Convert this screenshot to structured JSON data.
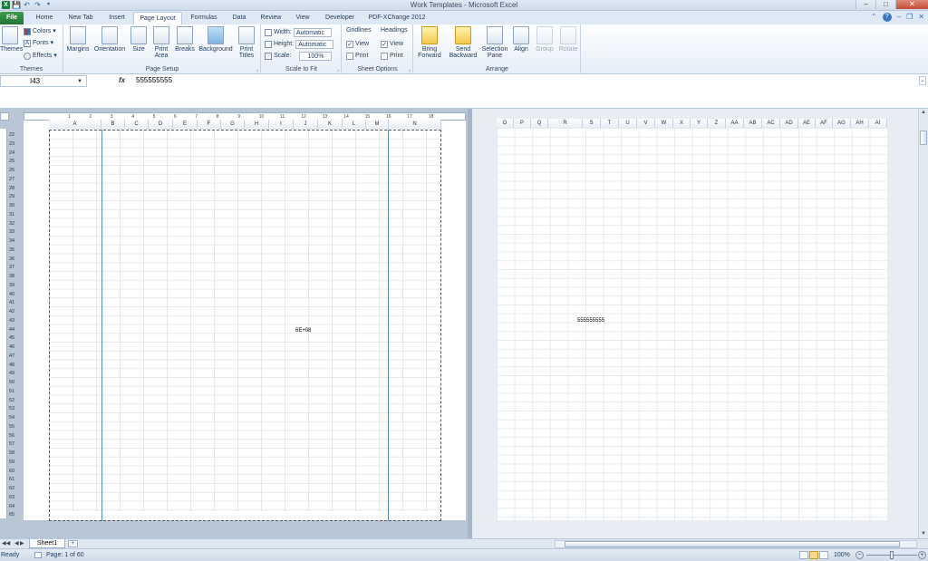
{
  "window": {
    "title": "Work Templates - Microsoft Excel",
    "app_icon_letter": "X",
    "quick_access": [
      "save-icon",
      "undo-icon",
      "redo-icon",
      "customize-icon"
    ],
    "controls": {
      "minimize": "–",
      "maximize": "□",
      "close": "✕"
    }
  },
  "tabs": [
    {
      "label": "File"
    },
    {
      "label": "Home"
    },
    {
      "label": "New Tab"
    },
    {
      "label": "Insert"
    },
    {
      "label": "Page Layout"
    },
    {
      "label": "Formulas"
    },
    {
      "label": "Data"
    },
    {
      "label": "Review"
    },
    {
      "label": "View"
    },
    {
      "label": "Developer"
    },
    {
      "label": "PDF-XChange 2012"
    }
  ],
  "ribbon": {
    "themes": {
      "label": "Themes",
      "themes_btn": "Themes",
      "colors": "Colors",
      "fonts": "Fonts",
      "effects": "Effects"
    },
    "page_setup": {
      "label": "Page Setup",
      "buttons": [
        "Margins",
        "Orientation",
        "Size",
        "Print Area",
        "Breaks",
        "Background",
        "Print Titles"
      ]
    },
    "scale_to_fit": {
      "label": "Scale to Fit",
      "width_label": "Width:",
      "width_value": "Automatic",
      "height_label": "Height:",
      "height_value": "Automatic",
      "scale_label": "Scale:",
      "scale_value": "100%"
    },
    "sheet_options": {
      "label": "Sheet Options",
      "gridlines": "Gridlines",
      "headings": "Headings",
      "view": "View",
      "print": "Print",
      "gridlines_view": true,
      "gridlines_print": false,
      "headings_view": true,
      "headings_print": false
    },
    "arrange": {
      "label": "Arrange",
      "buttons": [
        "Bring Forward",
        "Send Backward",
        "Selection Pane",
        "Align",
        "Group",
        "Rotate"
      ]
    }
  },
  "formula_bar": {
    "name_box": "I43",
    "fx": "fx",
    "value": "555555555"
  },
  "sheet": {
    "ruler_numbers": [
      "1",
      "2",
      "3",
      "4",
      "5",
      "6",
      "7",
      "8",
      "9",
      "10",
      "11",
      "12",
      "13",
      "14",
      "15",
      "16",
      "17",
      "18"
    ],
    "left_columns": [
      "A",
      "B",
      "C",
      "D",
      "E",
      "F",
      "G",
      "H",
      "I",
      "J",
      "K",
      "L",
      "M",
      "N"
    ],
    "right_columns": [
      "O",
      "P",
      "Q",
      "R",
      "S",
      "T",
      "U",
      "V",
      "W",
      "X",
      "Y",
      "Z",
      "AA",
      "AB",
      "AC",
      "AD",
      "AE",
      "AF",
      "AG",
      "AH",
      "AI"
    ],
    "rows": [
      "22",
      "23",
      "24",
      "25",
      "26",
      "27",
      "28",
      "29",
      "30",
      "31",
      "32",
      "33",
      "34",
      "35",
      "36",
      "37",
      "38",
      "39",
      "40",
      "41",
      "42",
      "43",
      "44",
      "45",
      "46",
      "47",
      "48",
      "49",
      "50",
      "51",
      "52",
      "53",
      "54",
      "55",
      "56",
      "57",
      "58",
      "59",
      "60",
      "61",
      "62",
      "63",
      "64",
      "65"
    ],
    "cell_i43_display": "6E+08",
    "cell_r43_display": "555555555"
  },
  "sheet_tabs": {
    "sheet1": "Sheet1"
  },
  "status": {
    "ready": "Ready",
    "page_info": "Page: 1 of 60",
    "zoom": "100%",
    "zoom_fraction": 0.5
  },
  "colors": {
    "accent": "#1e395b",
    "file_tab": "#237536",
    "page_break": "#4a8bd0"
  }
}
